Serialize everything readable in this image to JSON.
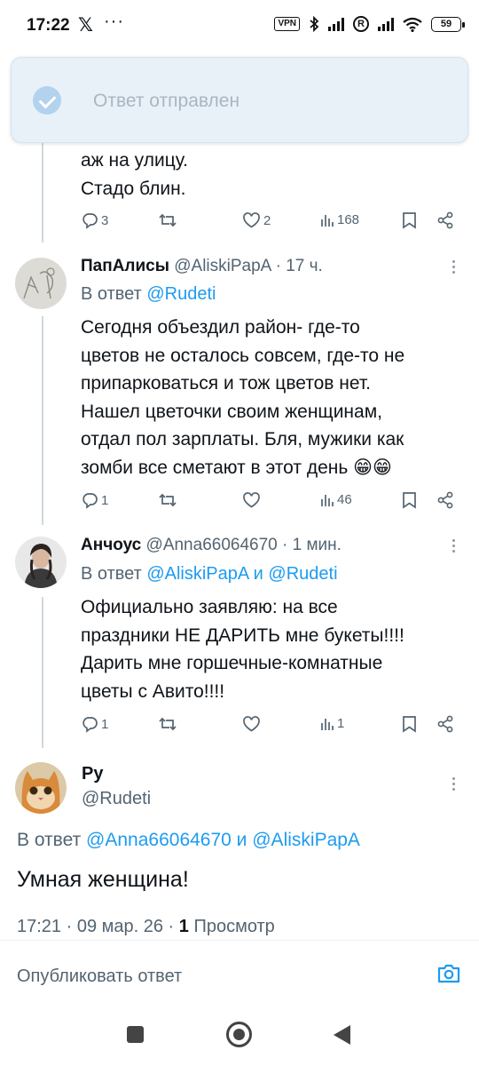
{
  "status_bar": {
    "time": "17:22",
    "x_glyph": "𝕏",
    "dots": "···",
    "vpn": "VPN",
    "registered": "R",
    "battery": "59"
  },
  "toast": {
    "text": "Ответ отправлен",
    "icon": "check-circle-icon"
  },
  "posts": [
    {
      "text_lines": [
        "аж на улицу.",
        "Стадо блин."
      ],
      "replies": "3",
      "retweets": "",
      "likes": "2",
      "views": "168"
    },
    {
      "name": "ПапАлисы",
      "handle": "@AliskiPapA",
      "time": "· 17 ч.",
      "reply_prefix": "В ответ",
      "reply_to": "@Rudeti",
      "text_lines": [
        "Сегодня объездил район- где-то",
        "цветов не осталось совсем, где-то не",
        "припарковаться и тож цветов нет.",
        "Нашел цветочки своим женщинам,",
        "отдал пол зарплаты. Бля, мужики как",
        "зомби все сметают в этот день 😁😁"
      ],
      "replies": "1",
      "retweets": "",
      "likes": "",
      "views": "46"
    },
    {
      "name": "Анчоус",
      "handle": "@Anna66064670",
      "time": "· 1 мин.",
      "reply_prefix": "В ответ",
      "reply_to": "@AliskiPapA и @Rudeti",
      "text_lines": [
        "Официально заявляю: на все",
        "праздники НЕ ДАРИТЬ мне букеты!!!!",
        "Дарить мне горшечные-комнатные",
        "цветы с Авито!!!!"
      ],
      "replies": "1",
      "retweets": "",
      "likes": "",
      "views": "1"
    }
  ],
  "focused": {
    "name": "Ру",
    "handle": "@Rudeti",
    "reply_prefix": "В ответ",
    "reply_to": "@Anna66064670 и @AliskiPapA",
    "text": "Умная женщина!",
    "meta_prefix": "17:21 · 09 мар. 26 ·",
    "views_count": "1",
    "views_label": "Просмотр"
  },
  "composer": {
    "placeholder": "Опубликовать ответ"
  },
  "colors": {
    "accent": "#1d9bf0",
    "text": "#0f1419",
    "secondary": "#536471",
    "toast_bg": "#e9f1f8"
  }
}
